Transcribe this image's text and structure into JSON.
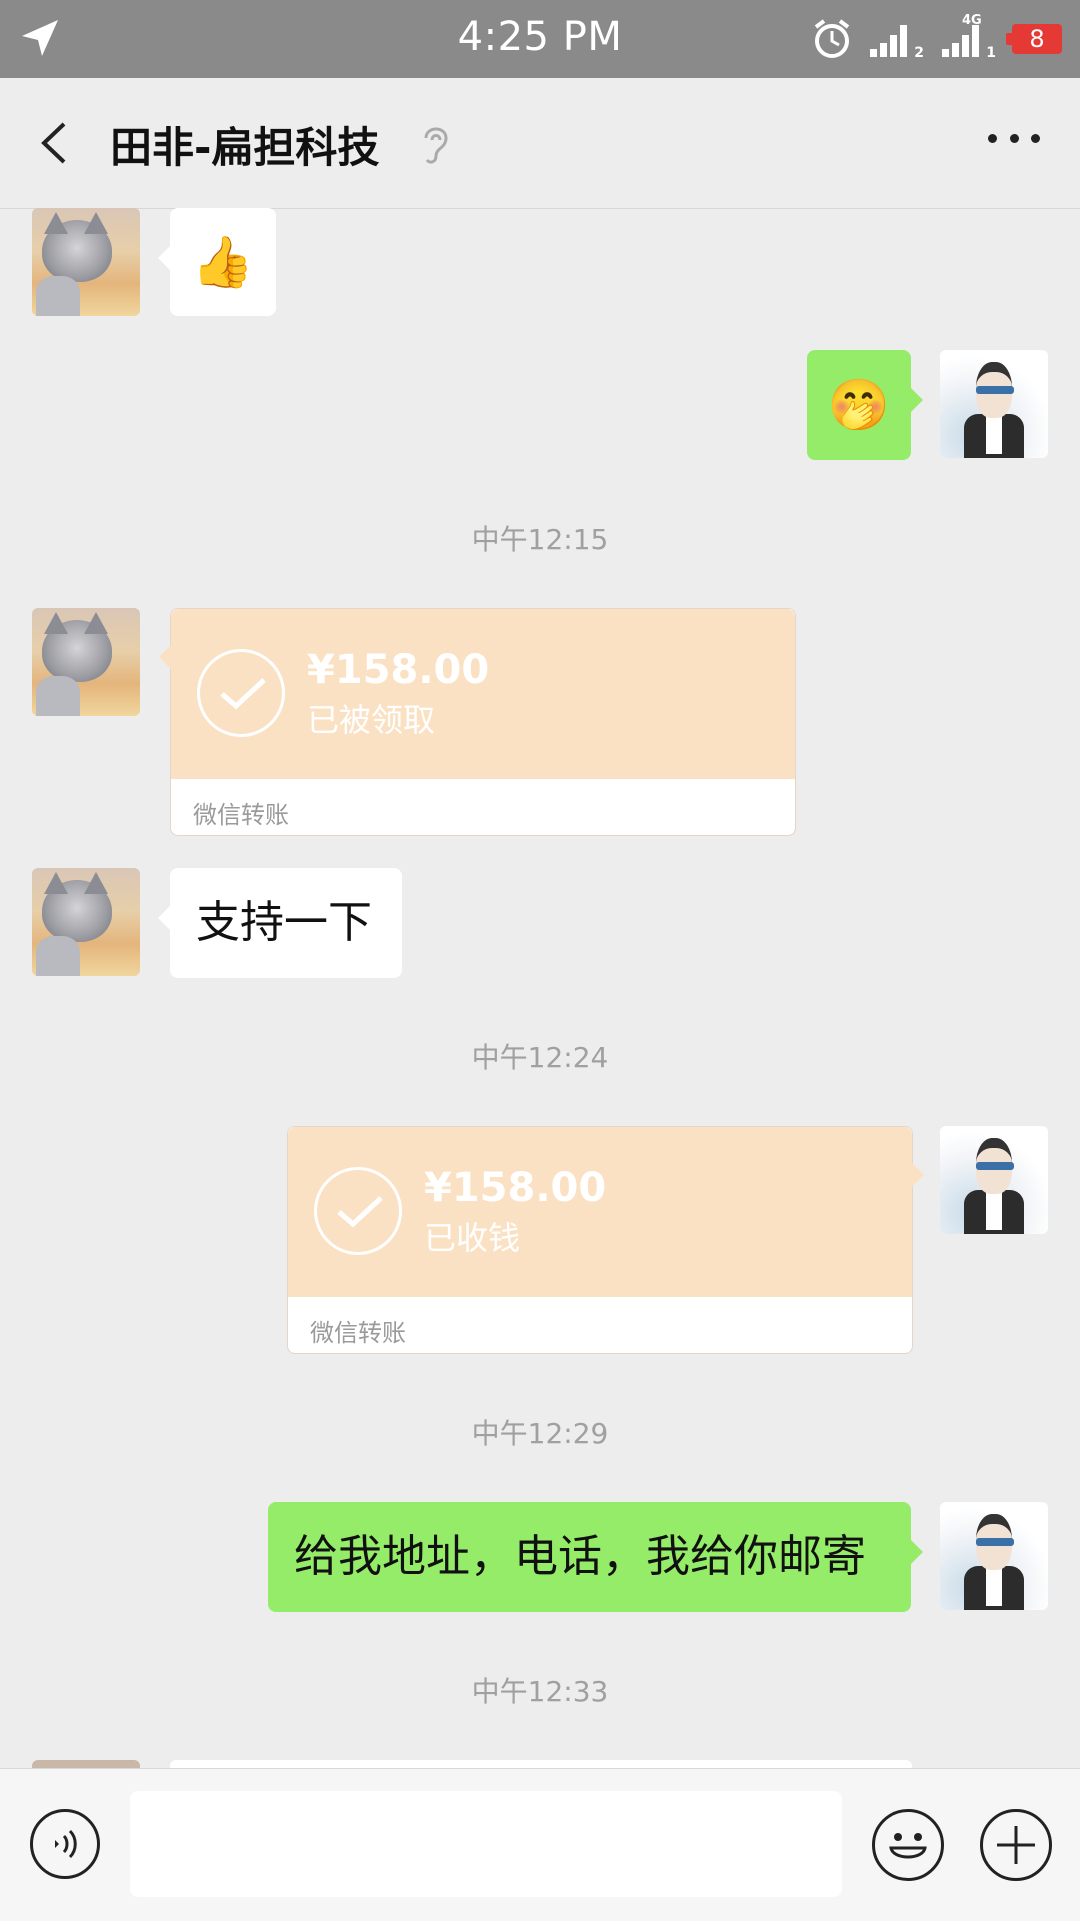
{
  "status_bar": {
    "time": "4:25 PM",
    "signal_1_sub": "2",
    "signal_2_sub": "1",
    "signal_2_label": "4G",
    "battery": "8"
  },
  "header": {
    "title": "田非-扁担科技"
  },
  "messages": {
    "m1_emoji": "👍",
    "m2_emoji": "🤭",
    "ts1": "中午12:15",
    "transfer1": {
      "amount": "¥158.00",
      "status": "已被领取",
      "label": "微信转账"
    },
    "m3_text": "支持一下",
    "ts2": "中午12:24",
    "transfer2": {
      "amount": "¥158.00",
      "status": "已收钱",
      "label": "微信转账"
    },
    "ts3": "中午12:29",
    "m4_text": "给我地址，电话，我给你邮寄",
    "ts4": "中午12:33"
  },
  "colors": {
    "status_bar_bg": "#8a8a8a",
    "chat_bg": "#ededed",
    "bubble_green": "#95ec69",
    "transfer_orange": "#fbe1c3",
    "battery_red": "#e53935"
  },
  "icons": {
    "location": "location-arrow-icon",
    "alarm": "alarm-clock-icon",
    "back": "chevron-left-icon",
    "ear": "ear-icon",
    "more": "more-dots-icon",
    "voice": "voice-icon",
    "emoji": "emoji-icon",
    "plus": "plus-icon",
    "check": "check-icon"
  }
}
